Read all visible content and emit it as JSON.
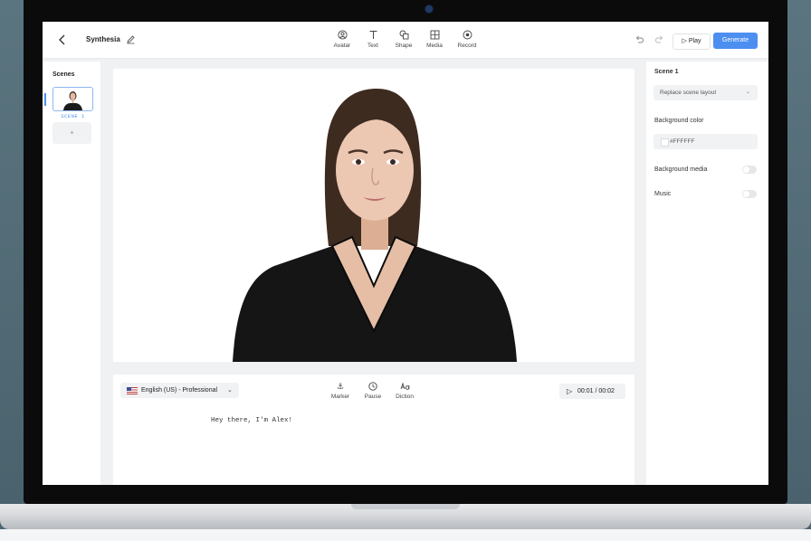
{
  "project": {
    "title": "Synthesia"
  },
  "toolbar": {
    "tools": [
      {
        "label": "Avatar",
        "icon": "avatar-icon"
      },
      {
        "label": "Text",
        "icon": "text-icon"
      },
      {
        "label": "Shape",
        "icon": "shape-icon"
      },
      {
        "label": "Media",
        "icon": "media-icon"
      },
      {
        "label": "Record",
        "icon": "record-icon"
      }
    ],
    "play_label": "Play",
    "generate_label": "Generate"
  },
  "scenes": {
    "title": "Scenes",
    "items": [
      {
        "label": "SCENE 1"
      }
    ],
    "add_label": "+"
  },
  "script": {
    "language": "English (US) - Professional",
    "tools": [
      {
        "label": "Marker",
        "icon": "marker-icon"
      },
      {
        "label": "Pause",
        "icon": "clock-icon"
      },
      {
        "label": "Diction",
        "icon": "diction-icon"
      }
    ],
    "timer": "00:01 / 00:02",
    "text": "Hey there, I'm Alex!"
  },
  "properties": {
    "scene_title": "Scene 1",
    "layout_placeholder": "Replace scene layout",
    "bg_color_label": "Background color",
    "bg_color_value": "#FFFFFF",
    "bg_media_label": "Background media",
    "music_label": "Music"
  },
  "colors": {
    "accent": "#4c8ff0",
    "top_bg": "#5b7580",
    "bezel": "#0b0b0c"
  }
}
